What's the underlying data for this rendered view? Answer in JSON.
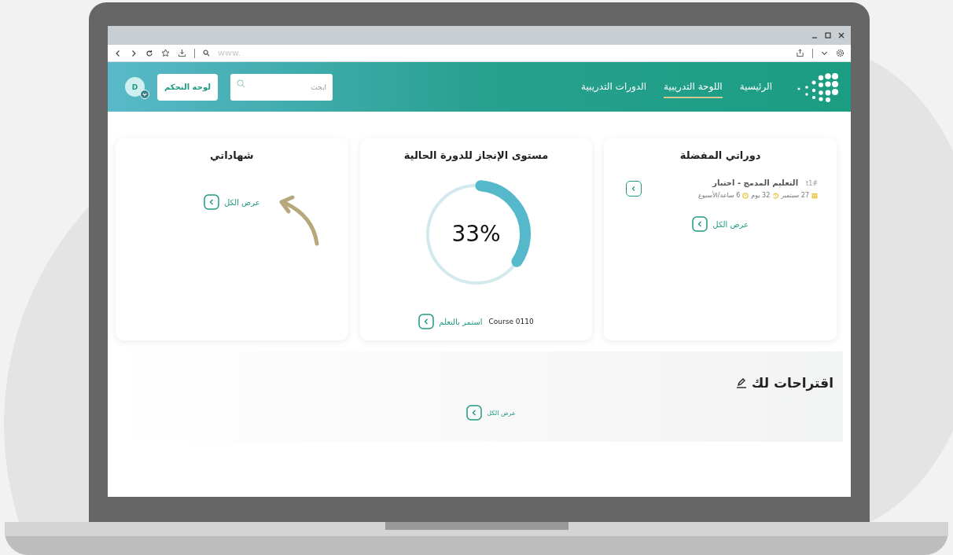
{
  "browser": {
    "address": "www."
  },
  "header": {
    "nav": [
      {
        "label": "الرئيسية",
        "selected": false
      },
      {
        "label": "اللوحة التدريبية",
        "selected": true
      },
      {
        "label": "الدورات التدريبية",
        "selected": false
      }
    ],
    "search": {
      "placeholder": "ابحث"
    },
    "dashboard_button": "لوحة التحكم",
    "avatar": "D"
  },
  "favorites": {
    "title": "دوراتي المفضلة",
    "course": {
      "number": "t1#",
      "title": "التعليم المدمج - اختبار",
      "date": "27 سبتمبر",
      "duration": "32 يوم",
      "hours": "6 ساعة/الأسبوع"
    },
    "view_all": "عرض الكل"
  },
  "progress": {
    "title": "مستوى الإنجاز للدورة الحالية",
    "level": 0.33,
    "percent": "33%",
    "course": "Course 0110",
    "continue": "استمر بالتعلم"
  },
  "certificates": {
    "title": "شهاداتي",
    "view_all": "عرض الكل"
  },
  "suggestions": {
    "title": "اقتراحات لك",
    "view_all": "عرض الكل"
  }
}
